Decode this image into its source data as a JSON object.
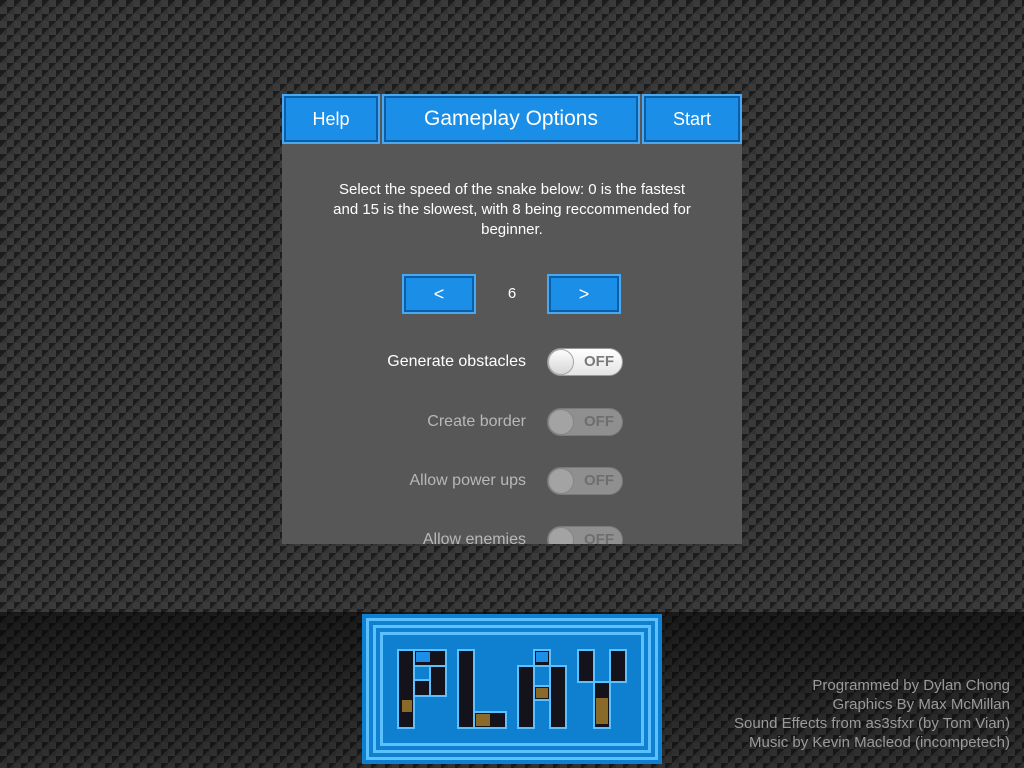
{
  "header": {
    "help_label": "Help",
    "title": "Gameplay Options",
    "start_label": "Start"
  },
  "speed": {
    "description": "Select the speed of the snake below: 0 is the fastest and 15 is the slowest, with 8 being reccommended for beginner.",
    "decrement_label": "<",
    "increment_label": ">",
    "value": "6"
  },
  "options": [
    {
      "label": "Generate obstacles",
      "state": "OFF",
      "enabled": true
    },
    {
      "label": "Create border",
      "state": "OFF",
      "enabled": false
    },
    {
      "label": "Allow power ups",
      "state": "OFF",
      "enabled": false
    },
    {
      "label": "Allow enemies",
      "state": "OFF",
      "enabled": false
    }
  ],
  "play_button": {
    "text": "PLAY",
    "icon": "pixel-play-logo"
  },
  "credits": [
    "Programmed by Dylan Chong",
    "Graphics By Max McMillan",
    "Sound Effects from as3sfxr (by Tom Vian)",
    "Music by Kevin Macleod (incompetech)"
  ],
  "colors": {
    "accent_blue": "#1b8ee8",
    "panel_gray": "#575757",
    "pixel_dark": "#14121a",
    "pixel_gold": "#8a6a28"
  }
}
